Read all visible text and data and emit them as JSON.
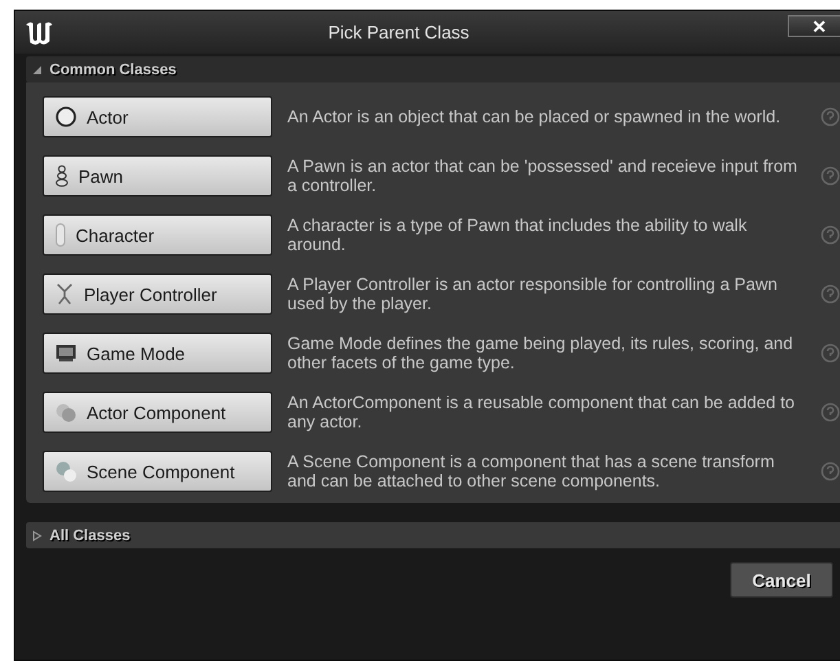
{
  "window": {
    "title": "Pick Parent Class",
    "close": "✕"
  },
  "sections": [
    {
      "title": "Common Classes",
      "expanded": true,
      "classes": [
        {
          "name": "Actor",
          "description": "An Actor is an object that can be placed or spawned in the world."
        },
        {
          "name": "Pawn",
          "description": "A Pawn is an actor that can be 'possessed' and receieve input from a controller."
        },
        {
          "name": "Character",
          "description": "A character is a type of Pawn that includes the ability to walk around."
        },
        {
          "name": "Player Controller",
          "description": "A Player Controller is an actor responsible for controlling a Pawn used by the player."
        },
        {
          "name": "Game Mode",
          "description": "Game Mode defines the game being played, its rules, scoring, and other facets of the game type."
        },
        {
          "name": "Actor Component",
          "description": "An ActorComponent is a reusable component that can be added to any actor."
        },
        {
          "name": "Scene Component",
          "description": "A Scene Component is a component that has a scene transform and can be attached to other scene components."
        }
      ]
    },
    {
      "title": "All Classes",
      "expanded": false
    }
  ],
  "buttons": [
    "Cancel"
  ]
}
